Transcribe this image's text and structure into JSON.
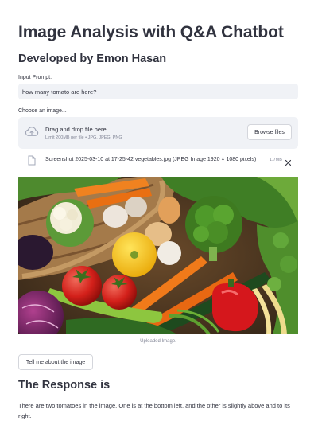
{
  "header": {
    "title": "Image Analysis with Q&A Chatbot",
    "subtitle": "Developed by Emon Hasan"
  },
  "prompt": {
    "label": "Input Prompt:",
    "value": "how many tomato are here?"
  },
  "uploader": {
    "label": "Choose an image...",
    "drag_text": "Drag and drop file here",
    "limit_text": "Limit 200MB per file • JPG, JPEG, PNG",
    "browse_label": "Browse files",
    "file": {
      "name": "Screenshot 2025-03-10 at 17-25-42 vegetables.jpg (JPEG Image 1920 × 1080 pixels)",
      "size": "1.7MB"
    }
  },
  "image": {
    "caption": "Uploaded Image."
  },
  "action": {
    "button_label": "Tell me about the image"
  },
  "response": {
    "heading": "The Response is",
    "text": "There are two tomatoes in the image. One is at the bottom left, and the other is slightly above and to its right."
  },
  "colors": {
    "text": "#31333F",
    "muted": "#808495",
    "input_bg": "#F0F2F6",
    "border": "#D4D6DC"
  },
  "icons": {
    "upload": "cloud-upload-icon",
    "file": "file-icon",
    "remove": "close-icon"
  }
}
